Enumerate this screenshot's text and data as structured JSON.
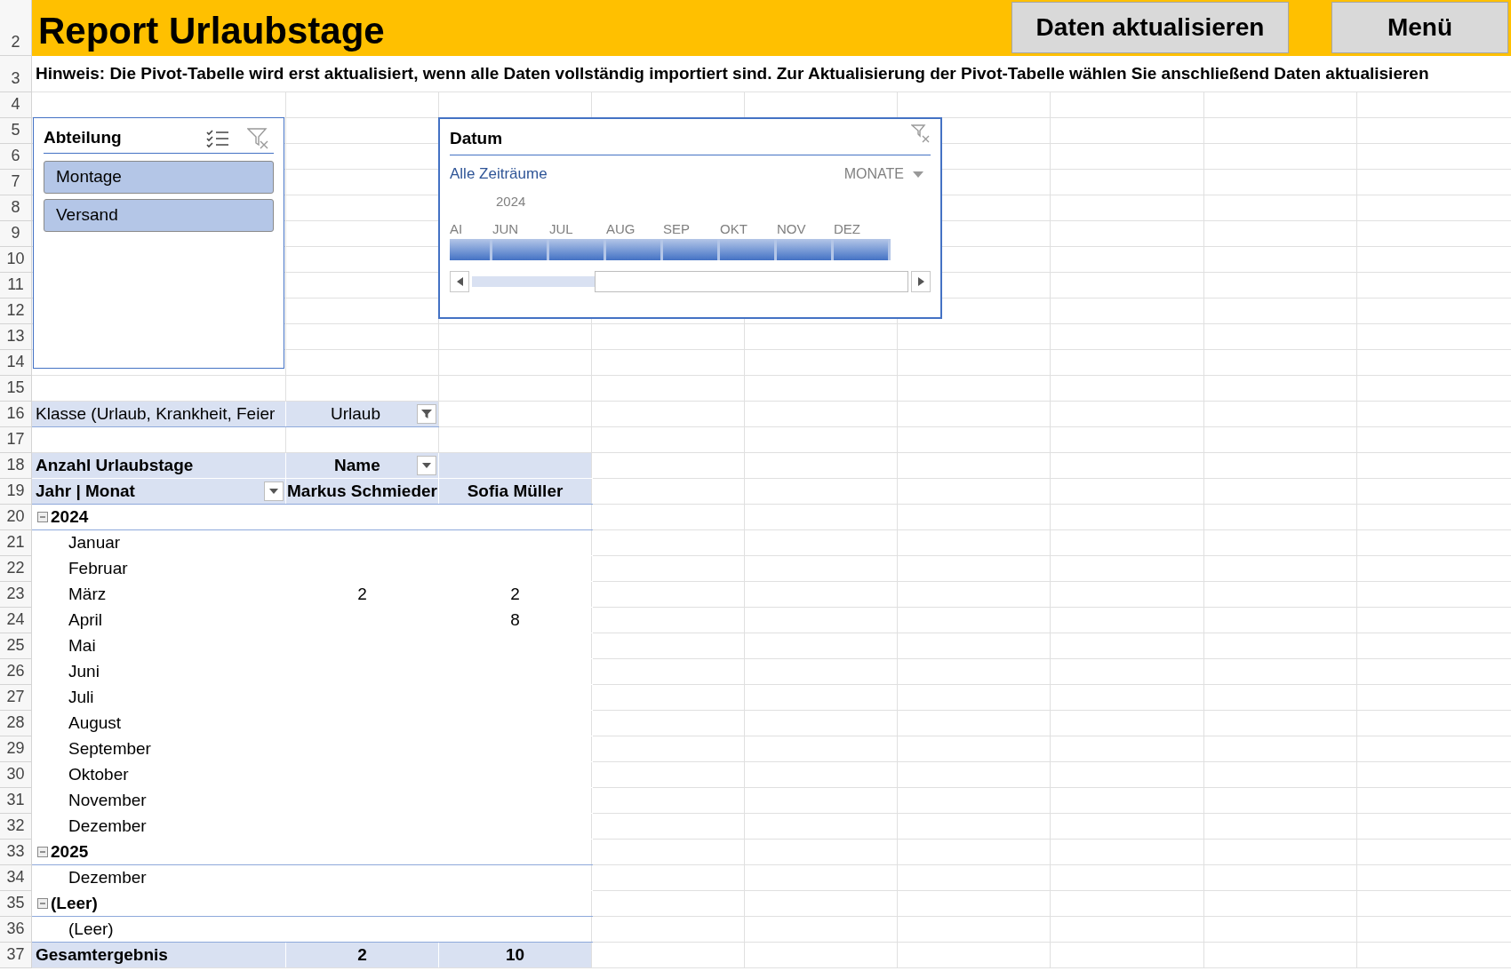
{
  "sheet": {
    "title": "Report Urlaubstage",
    "buttons": [
      "Daten aktualisieren",
      "Menü"
    ],
    "hint": "Hinweis: Die Pivot-Tabelle wird erst aktualisiert, wenn alle Daten vollständig importiert sind. Zur Aktualisierung der Pivot-Tabelle wählen Sie anschließend Daten aktualisieren",
    "row_headers": [
      "2",
      "3",
      "4",
      "5",
      "6",
      "7",
      "8",
      "9",
      "10",
      "11",
      "12",
      "13",
      "14",
      "15",
      "16",
      "17",
      "18",
      "19",
      "20",
      "21",
      "22",
      "23",
      "24",
      "25",
      "26",
      "27",
      "28",
      "29",
      "30",
      "31",
      "32",
      "33",
      "34",
      "35",
      "36",
      "37"
    ]
  },
  "slicer": {
    "title": "Abteilung",
    "items": [
      {
        "label": "Montage",
        "selected": true
      },
      {
        "label": "Versand",
        "selected": true
      }
    ]
  },
  "timeline": {
    "title": "Datum",
    "range_label": "Alle Zeiträume",
    "level_label": "MONATE",
    "year": "2024",
    "months": [
      {
        "label": "AI",
        "selected": true
      },
      {
        "label": "JUN",
        "selected": true
      },
      {
        "label": "JUL",
        "selected": true
      },
      {
        "label": "AUG",
        "selected": true
      },
      {
        "label": "SEP",
        "selected": true
      },
      {
        "label": "OKT",
        "selected": true
      },
      {
        "label": "NOV",
        "selected": true
      },
      {
        "label": "DEZ",
        "selected": true
      }
    ]
  },
  "pivot": {
    "report_filter": {
      "field": "Klasse (Urlaub, Krankheit, Feier",
      "value": "Urlaub"
    },
    "value_field": "Anzahl Urlaubstage",
    "column_field": "Name",
    "row_field": "Jahr | Monat",
    "columns": [
      "Markus Schmieder",
      "Sofia Müller"
    ],
    "groups": [
      {
        "label": "2024",
        "expanded": true,
        "rows": [
          {
            "label": "Januar"
          },
          {
            "label": "Februar"
          },
          {
            "label": "März",
            "column_1": "2",
            "column_2": "2"
          },
          {
            "label": "April",
            "column_2": "8"
          },
          {
            "label": "Mai"
          },
          {
            "label": "Juni"
          },
          {
            "label": "Juli"
          },
          {
            "label": "August"
          },
          {
            "label": "September"
          },
          {
            "label": "Oktober"
          },
          {
            "label": "November"
          },
          {
            "label": "Dezember"
          }
        ]
      },
      {
        "label": "2025",
        "expanded": true,
        "rows": [
          {
            "label": "Dezember"
          }
        ]
      },
      {
        "label": "(Leer)",
        "expanded": true,
        "rows": [
          {
            "label": "(Leer)"
          }
        ]
      }
    ],
    "total": {
      "label": "Gesamtergebnis",
      "column_1": "2",
      "column_2": "10"
    }
  }
}
